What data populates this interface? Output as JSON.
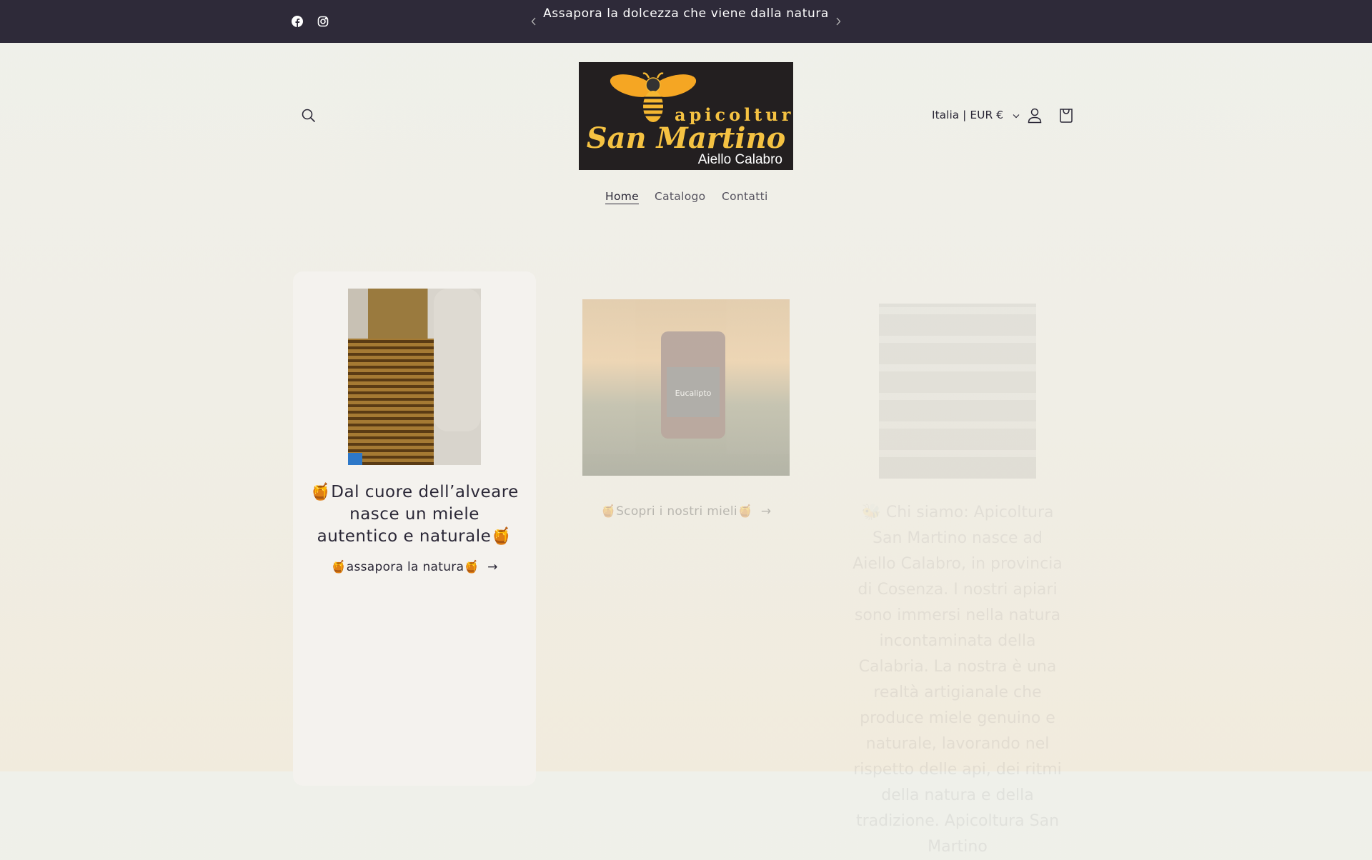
{
  "announcement": {
    "text": "Assapora la dolcezza che viene dalla natura",
    "social": [
      "facebook-icon",
      "instagram-icon"
    ]
  },
  "logo": {
    "line1": "apicoltura",
    "line2": "San Martino",
    "line3": "Aiello Calabro"
  },
  "header": {
    "locale": "Italia | EUR €"
  },
  "nav": [
    {
      "label": "Home",
      "active": true
    },
    {
      "label": "Catalogo"
    },
    {
      "label": "Contatti"
    }
  ],
  "cards": [
    {
      "heading": "🍯Dal cuore dell’alveare nasce un miele autentico e naturale🍯",
      "link": "🍯assapora la natura🍯"
    },
    {
      "link": "🍯Scopri i nostri mieli🍯",
      "image_label": "Eucalipto"
    },
    {
      "text": "🐝 Chi siamo: Apicoltura San Martino nasce ad Aiello Calabro, in provincia di Cosenza. I nostri apiari sono immersi nella natura incontaminata della Calabria. La nostra è una realtà artigianale che produce miele genuino e naturale, lavorando nel rispetto delle api, dei ritmi della natura e della tradizione. Apicoltura San Martino"
    }
  ],
  "colors": {
    "bar": "#2e2a39",
    "text": "#2b2837",
    "honey": "#f5b731"
  }
}
